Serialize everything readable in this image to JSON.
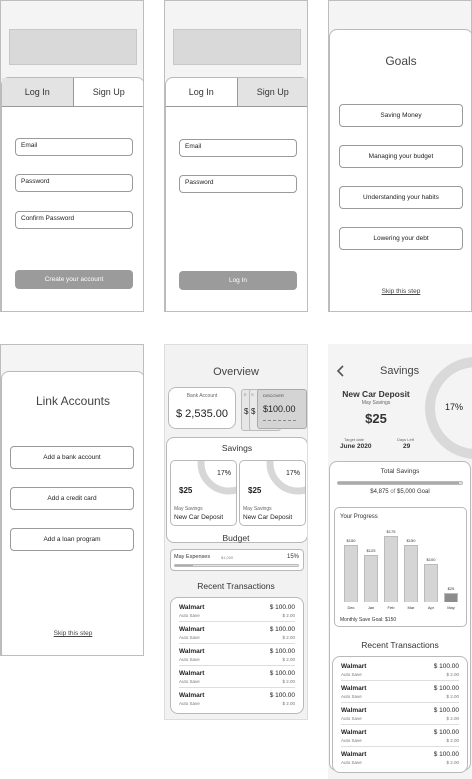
{
  "login": {
    "tab_login": "Log In",
    "tab_signup": "Sign Up",
    "email": "Email",
    "password": "Password",
    "button": "Log In"
  },
  "signup": {
    "tab_login": "Log In",
    "tab_signup": "Sign Up",
    "email": "Email",
    "password": "Password",
    "confirm": "Confirm Password",
    "button": "Create your account"
  },
  "goals": {
    "title": "Goals",
    "items": [
      "Saving Money",
      "Managing your budget",
      "Understanding your habits",
      "Lowering your debt"
    ],
    "skip": "Skip this step"
  },
  "link_accounts": {
    "title": "Link Accounts",
    "items": [
      "Add a bank account",
      "Add a credit card",
      "Add a loan program"
    ],
    "skip": "Skip this step"
  },
  "overview": {
    "title": "Overview",
    "bank_label": "Bank Account",
    "bank_amount": "$ 2,535.00",
    "card_label": "DISCOVER",
    "card_amount": "$100.00",
    "card_letters": [
      "E",
      "S",
      "$",
      "$"
    ],
    "savings_title": "Savings",
    "savings_cards": [
      {
        "percent": "17%",
        "percent_value": 17,
        "amount": "$25",
        "label": "May Savings",
        "goal": "New Car Deposit"
      },
      {
        "percent": "17%",
        "percent_value": 17,
        "amount": "$25",
        "label": "May Savings",
        "goal": "New Car Deposit"
      }
    ],
    "budget_title": "Budget",
    "budget_label": "May Expenses",
    "budget_amount": "$1,000",
    "budget_percent": "15%",
    "budget_percent_value": 15,
    "recent_title": "Recent Transactions",
    "transactions": [
      {
        "name": "Walmart",
        "sub": "Auto Save",
        "amount": "$ 100.00",
        "amount2": "$ 2.00"
      },
      {
        "name": "Walmart",
        "sub": "Auto Save",
        "amount": "$ 100.00",
        "amount2": "$ 2.00"
      },
      {
        "name": "Walmart",
        "sub": "Auto Save",
        "amount": "$ 100.00",
        "amount2": "$ 2.00"
      },
      {
        "name": "Walmart",
        "sub": "Auto Save",
        "amount": "$ 100.00",
        "amount2": "$ 2.00"
      },
      {
        "name": "Walmart",
        "sub": "Auto Save",
        "amount": "$ 100.00",
        "amount2": "$ 2.00"
      }
    ]
  },
  "savings": {
    "title": "Savings",
    "back_icon": "chevron-left-icon",
    "goal_name": "New Car Deposit",
    "goal_sub": "May Savings",
    "amount": "$25",
    "percent": "17%",
    "percent_value": 17,
    "target_label": "Target date",
    "target_value": "June 2020",
    "days_label": "Days Left",
    "days_value": "29",
    "total_title": "Total Savings",
    "total_amount": "$4,875",
    "total_of": "of",
    "total_goal": "$5,000 Goal",
    "total_fraction": 0.975,
    "progress_title": "Your Progress",
    "monthly_goal": "Monthly Save Goal: $150",
    "recent_title": "Recent Transactions",
    "transactions": [
      {
        "name": "Walmart",
        "sub": "Auto Save",
        "amount": "$ 100.00",
        "amount2": "$ 2.00"
      },
      {
        "name": "Walmart",
        "sub": "Auto Save",
        "amount": "$ 100.00",
        "amount2": "$ 2.00"
      },
      {
        "name": "Walmart",
        "sub": "Auto Save",
        "amount": "$ 100.00",
        "amount2": "$ 2.00"
      },
      {
        "name": "Walmart",
        "sub": "Auto Save",
        "amount": "$ 100.00",
        "amount2": "$ 2.00"
      },
      {
        "name": "Walmart",
        "sub": "Auto Save",
        "amount": "$ 100.00",
        "amount2": "$ 2.00"
      }
    ]
  },
  "chart_data": {
    "type": "bar",
    "categories": [
      "Dec",
      "Jan",
      "Feb",
      "Mar",
      "Apr",
      "May"
    ],
    "values": [
      150,
      125,
      175,
      150,
      100,
      25
    ],
    "labels": [
      "$150",
      "$125",
      "$175",
      "$150",
      "$100",
      "$25"
    ],
    "ylim": [
      0,
      175
    ],
    "highlight_index": 5,
    "title": "Your Progress"
  }
}
